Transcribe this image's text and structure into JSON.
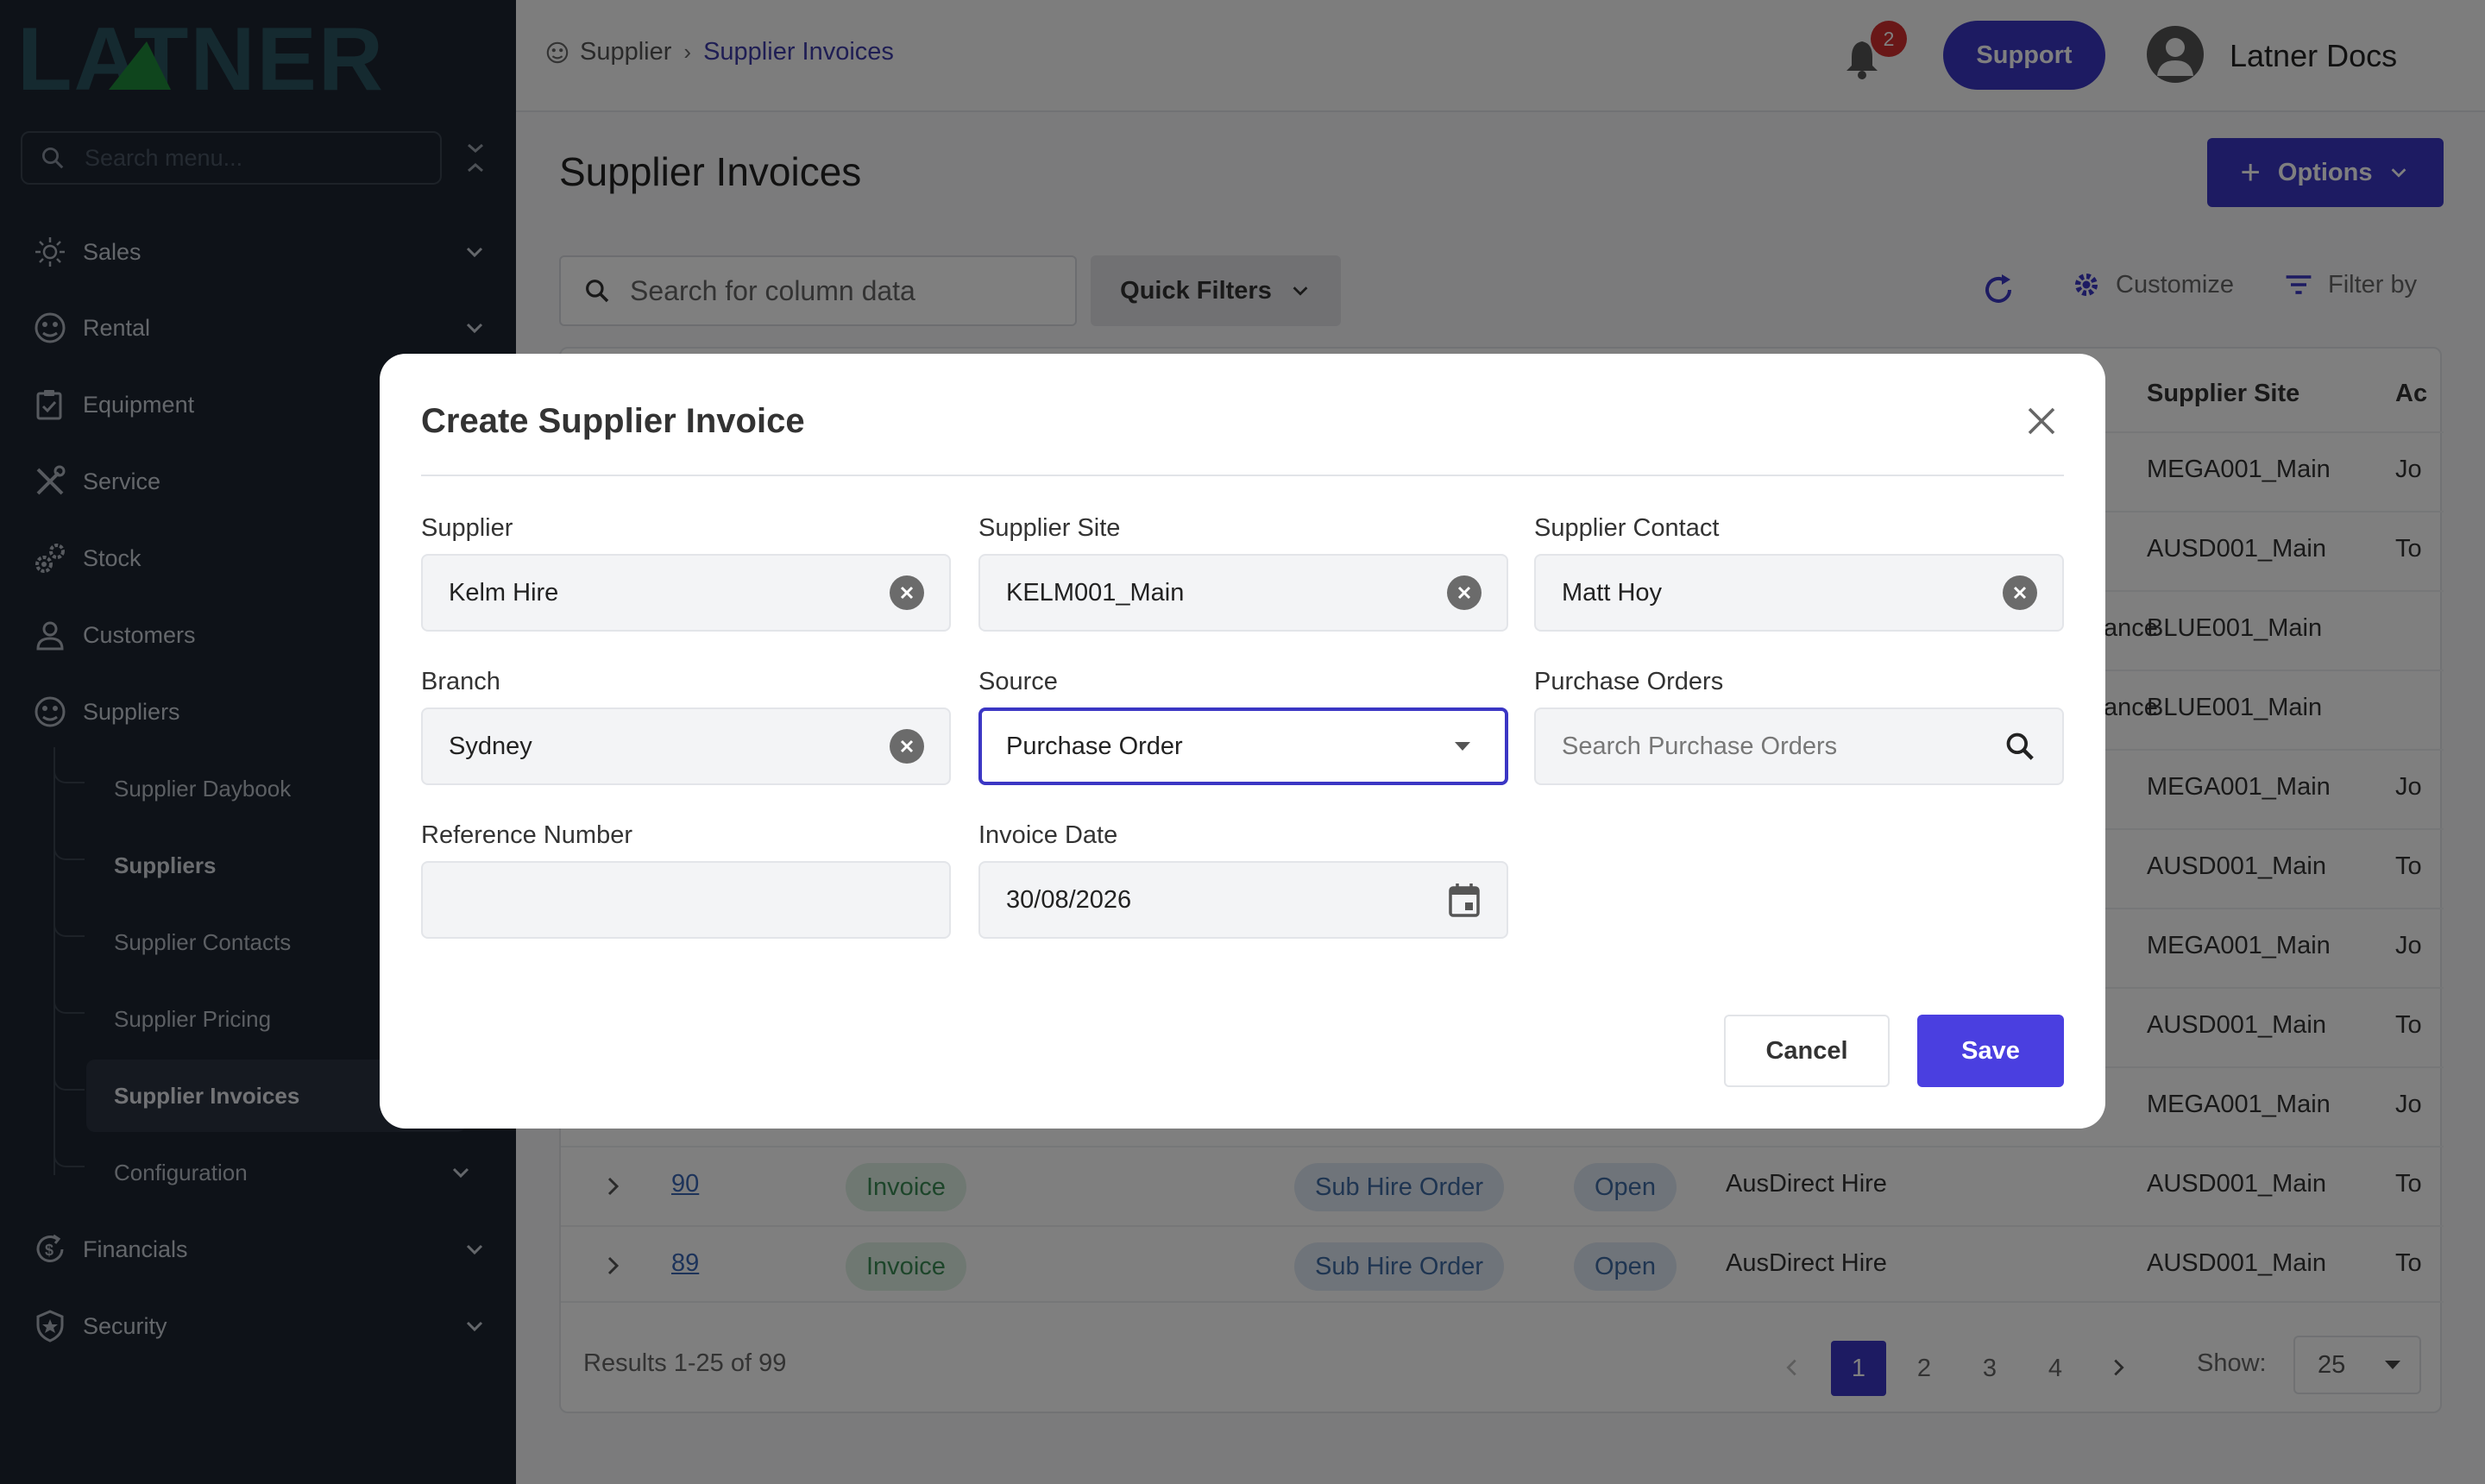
{
  "brand": {
    "logo_text": "LATNER"
  },
  "sidebar": {
    "search_placeholder": "Search menu...",
    "items": [
      {
        "label": "Sales",
        "icon": "sales-icon"
      },
      {
        "label": "Rental",
        "icon": "rental-icon"
      },
      {
        "label": "Equipment",
        "icon": "clipboard-icon"
      },
      {
        "label": "Service",
        "icon": "tools-icon"
      },
      {
        "label": "Stock",
        "icon": "gears-icon"
      },
      {
        "label": "Customers",
        "icon": "user-icon"
      },
      {
        "label": "Suppliers",
        "icon": "supplier-icon"
      },
      {
        "label": "Financials",
        "icon": "dollar-refresh-icon"
      },
      {
        "label": "Security",
        "icon": "shield-icon"
      }
    ],
    "sub_items": [
      {
        "label": "Supplier Daybook"
      },
      {
        "label": "Suppliers"
      },
      {
        "label": "Supplier Contacts"
      },
      {
        "label": "Supplier Pricing"
      },
      {
        "label": "Supplier Invoices"
      },
      {
        "label": "Configuration"
      }
    ]
  },
  "topbar": {
    "breadcrumb": [
      "Supplier",
      "Supplier Invoices"
    ],
    "notification_count": "2",
    "support_label": "Support",
    "user_name": "Latner Docs"
  },
  "page": {
    "title": "Supplier Invoices",
    "options_label": "Options",
    "search_placeholder": "Search for column data",
    "quick_filters_label": "Quick Filters",
    "customize_label": "Customize",
    "filter_by_label": "Filter by"
  },
  "table": {
    "visible_headers": {
      "supplier_site": "Supplier Site",
      "account": "Ac"
    },
    "rows": [
      {
        "status_tail": "",
        "site": "MEGA001_Main",
        "acct": "Jo"
      },
      {
        "status_tail": "",
        "site": "AUSD001_Main",
        "acct": "To"
      },
      {
        "status_tail": "ance",
        "site": "BLUE001_Main",
        "acct": ""
      },
      {
        "status_tail": "ance",
        "site": "BLUE001_Main",
        "acct": ""
      },
      {
        "status_tail": "",
        "site": "MEGA001_Main",
        "acct": "Jo"
      },
      {
        "status_tail": "",
        "site": "AUSD001_Main",
        "acct": "To"
      },
      {
        "status_tail": "",
        "site": "MEGA001_Main",
        "acct": "Jo"
      },
      {
        "status_tail": "",
        "site": "AUSD001_Main",
        "acct": "To"
      },
      {
        "status_tail": "",
        "site": "MEGA001_Main",
        "acct": "Jo"
      },
      {
        "id": "90",
        "type": "Invoice",
        "source": "Sub Hire Order",
        "status": "Open",
        "supplier": "AusDirect Hire",
        "site": "AUSD001_Main",
        "acct": "To"
      },
      {
        "id": "89",
        "type": "Invoice",
        "source": "Sub Hire Order",
        "status": "Open",
        "supplier": "AusDirect Hire",
        "site": "AUSD001_Main",
        "acct": "To"
      }
    ],
    "results_text": "Results 1-25 of 99",
    "pages": [
      "1",
      "2",
      "3",
      "4"
    ],
    "show_label": "Show:",
    "show_value": "25"
  },
  "modal": {
    "title": "Create Supplier Invoice",
    "fields": {
      "supplier": {
        "label": "Supplier",
        "value": "Kelm Hire"
      },
      "supplier_site": {
        "label": "Supplier Site",
        "value": "KELM001_Main"
      },
      "supplier_contact": {
        "label": "Supplier Contact",
        "value": "Matt Hoy"
      },
      "branch": {
        "label": "Branch",
        "value": "Sydney"
      },
      "source": {
        "label": "Source",
        "value": "Purchase Order"
      },
      "purchase_orders": {
        "label": "Purchase Orders",
        "placeholder": "Search Purchase Orders"
      },
      "reference_number": {
        "label": "Reference Number",
        "value": ""
      },
      "invoice_date": {
        "label": "Invoice Date",
        "value": "30/08/2026"
      }
    },
    "cancel_label": "Cancel",
    "save_label": "Save"
  },
  "colors": {
    "sidebar_bg": "#1c2430",
    "accent": "#3b36c4",
    "save": "#4a3fe0",
    "logo": "#2a5560",
    "logo_triangle": "#1f8a3a"
  }
}
